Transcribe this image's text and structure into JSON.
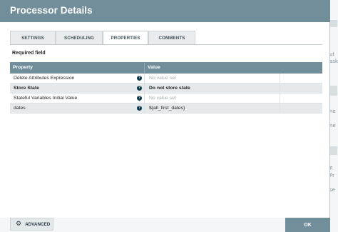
{
  "dialog": {
    "title": "Processor Details",
    "tabs": [
      {
        "label": "SETTINGS"
      },
      {
        "label": "SCHEDULING"
      },
      {
        "label": "PROPERTIES"
      },
      {
        "label": "COMMENTS"
      }
    ],
    "active_tab": "PROPERTIES",
    "required_label": "Required field"
  },
  "table": {
    "headers": {
      "property": "Property",
      "value": "Value"
    },
    "rows": [
      {
        "property": "Delete Attributes Expression",
        "value": "No value set",
        "required": false,
        "set": false
      },
      {
        "property": "Store State",
        "value": "Do not store state",
        "required": true,
        "set": true
      },
      {
        "property": "Stateful Variables Initial Value",
        "value": "No value set",
        "required": false,
        "set": false
      },
      {
        "property": "dates",
        "value": "${all_first_dates}",
        "required": false,
        "set": true
      }
    ],
    "help_icon": "question-circle-icon"
  },
  "footer": {
    "advanced_label": "ADVANCED",
    "advanced_icon": "gear-icon",
    "ok_label": "OK"
  },
  "colors": {
    "header": "#728e9b",
    "help_icon": "#0c3a4b",
    "muted_text": "#a4acb0"
  }
}
